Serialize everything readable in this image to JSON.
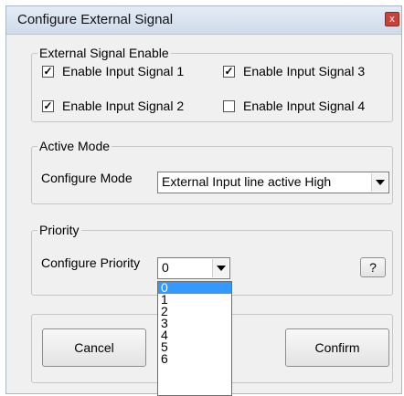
{
  "window": {
    "title": "Configure External Signal",
    "close_glyph": "x"
  },
  "signal_enable": {
    "legend": "External Signal Enable",
    "items": [
      {
        "label": "Enable Input Signal 1",
        "checked": true
      },
      {
        "label": "Enable Input Signal 3",
        "checked": true
      },
      {
        "label": "Enable Input Signal 2",
        "checked": true
      },
      {
        "label": "Enable Input Signal 4",
        "checked": false
      }
    ]
  },
  "active_mode": {
    "legend": "Active Mode",
    "label": "Configure Mode",
    "selected": "External Input line active High"
  },
  "priority": {
    "legend": "Priority",
    "label": "Configure Priority",
    "selected": "0",
    "help_label": "?",
    "options": [
      "0",
      "1",
      "2",
      "3",
      "4",
      "5",
      "6"
    ]
  },
  "buttons": {
    "cancel": "Cancel",
    "confirm": "Confirm"
  }
}
